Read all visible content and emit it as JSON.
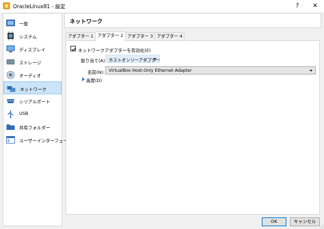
{
  "window": {
    "title": "OracleLinux81 - 設定",
    "help": "?",
    "close": "✕"
  },
  "sidebar": {
    "items": [
      {
        "label": "一般",
        "icon": "general-icon"
      },
      {
        "label": "システム",
        "icon": "system-icon"
      },
      {
        "label": "ディスプレイ",
        "icon": "display-icon"
      },
      {
        "label": "ストレージ",
        "icon": "storage-icon"
      },
      {
        "label": "オーディオ",
        "icon": "audio-icon"
      },
      {
        "label": "ネットワーク",
        "icon": "network-icon",
        "selected": true
      },
      {
        "label": "シリアルポート",
        "icon": "serial-port-icon"
      },
      {
        "label": "USB",
        "icon": "usb-icon"
      },
      {
        "label": "共有フォルダー",
        "icon": "shared-folder-icon"
      },
      {
        "label": "ユーザーインターフェース",
        "icon": "user-interface-icon"
      }
    ]
  },
  "page": {
    "title": "ネットワーク",
    "tabs": [
      {
        "label": "アダプター 1"
      },
      {
        "label": "アダプター 2",
        "active": true
      },
      {
        "label": "アダプター 3"
      },
      {
        "label": "アダプター 4"
      }
    ],
    "enable_adapter": {
      "label": "ネットワークアダプターを有効化(E)",
      "checked": true
    },
    "attached_to": {
      "label": "割り当て(A):",
      "value": "ホストオンリーアダプター"
    },
    "name": {
      "label": "名前(N):",
      "value": "VirtualBox Host-Only Ethernet Adapter"
    },
    "advanced": {
      "label": "高度(D)"
    }
  },
  "footer": {
    "ok": "OK",
    "cancel": "キャンセル"
  }
}
